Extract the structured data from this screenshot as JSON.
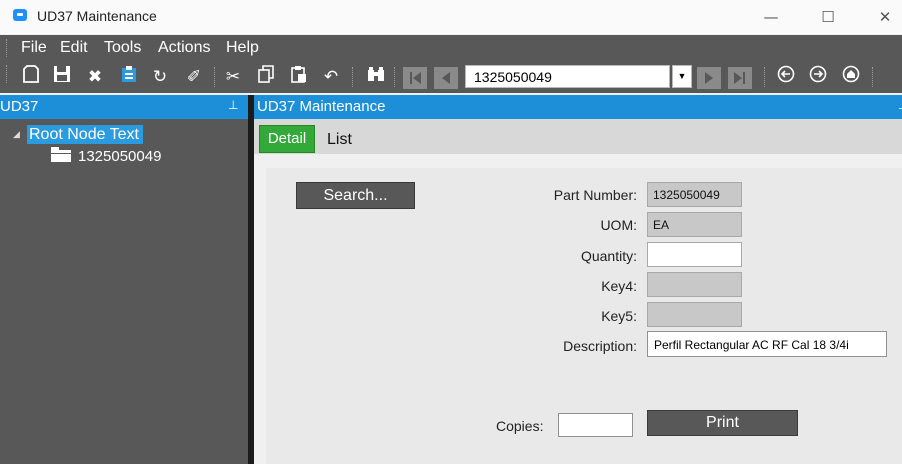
{
  "window": {
    "title": "UD37 Maintenance",
    "icon": "app-window-icon",
    "controls": {
      "minimize": "—",
      "maximize": "☐",
      "close": "✕"
    }
  },
  "menu": {
    "items": [
      "File",
      "Edit",
      "Tools",
      "Actions",
      "Help"
    ]
  },
  "toolbar": {
    "icons": [
      "new-icon",
      "save-icon",
      "delete-icon",
      "clipboard-icon",
      "refresh-icon",
      "clear-icon",
      "cut-icon",
      "copy-icon",
      "paste-icon",
      "undo-icon",
      "search-binoculars-icon",
      "first-record-icon",
      "previous-record-icon",
      "next-record-icon",
      "last-record-icon",
      "back-icon",
      "forward-icon",
      "home-icon"
    ],
    "record_combo_value": "1325050049"
  },
  "left_panel": {
    "title": "UD37",
    "tree": {
      "root": "Root Node Text",
      "children": [
        "1325050049"
      ]
    }
  },
  "right_panel": {
    "title": "UD37 Maintenance",
    "tabs": [
      {
        "label": "Detail",
        "active": true
      },
      {
        "label": "List",
        "active": false
      }
    ]
  },
  "form": {
    "search_button": "Search...",
    "part_number": {
      "label": "Part Number:",
      "value": "1325050049"
    },
    "uom": {
      "label": "UOM:",
      "value": "EA"
    },
    "quantity": {
      "label": "Quantity:",
      "value": ""
    },
    "key4": {
      "label": "Key4:",
      "value": ""
    },
    "key5": {
      "label": "Key5:",
      "value": ""
    },
    "description": {
      "label": "Description:",
      "value": "Perfil Rectangular AC RF Cal 18 3/4i"
    },
    "copies": {
      "label": "Copies:",
      "value": ""
    },
    "print_button": "Print"
  },
  "colors": {
    "accent_blue": "#1d8fd8",
    "tab_active_green": "#33a93a",
    "dark_gray": "#585858"
  }
}
